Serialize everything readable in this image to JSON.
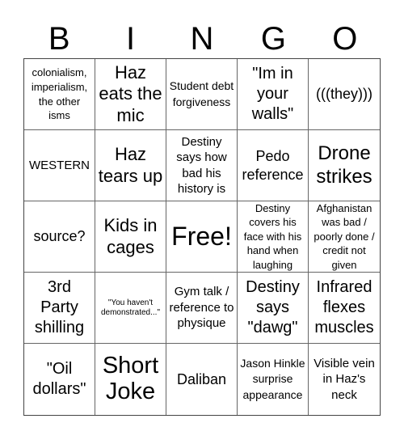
{
  "header": {
    "letters": [
      "B",
      "I",
      "N",
      "G",
      "O"
    ]
  },
  "board": {
    "cells": [
      "colonialism, imperialism, the other isms",
      "Haz eats the mic",
      "Student debt forgiveness",
      "\"Im in your walls\"",
      "(((they)))",
      "WESTERN",
      "Haz tears up",
      "Destiny says how bad his history is",
      "Pedo reference",
      "Drone strikes",
      "source?",
      "Kids in cages",
      "Free!",
      "Destiny covers his face with his hand when laughing",
      "Afghanistan was bad / poorly done / credit not given",
      "3rd Party shilling",
      "\"You haven't demonstrated...\"",
      "Gym talk / reference to physique",
      "Destiny says \"dawg\"",
      "Infrared flexes muscles",
      "\"Oil dollars\"",
      "Short Joke",
      "Daliban",
      "Jason Hinkle surprise appearance",
      "Visible vein in Haz's neck"
    ]
  }
}
